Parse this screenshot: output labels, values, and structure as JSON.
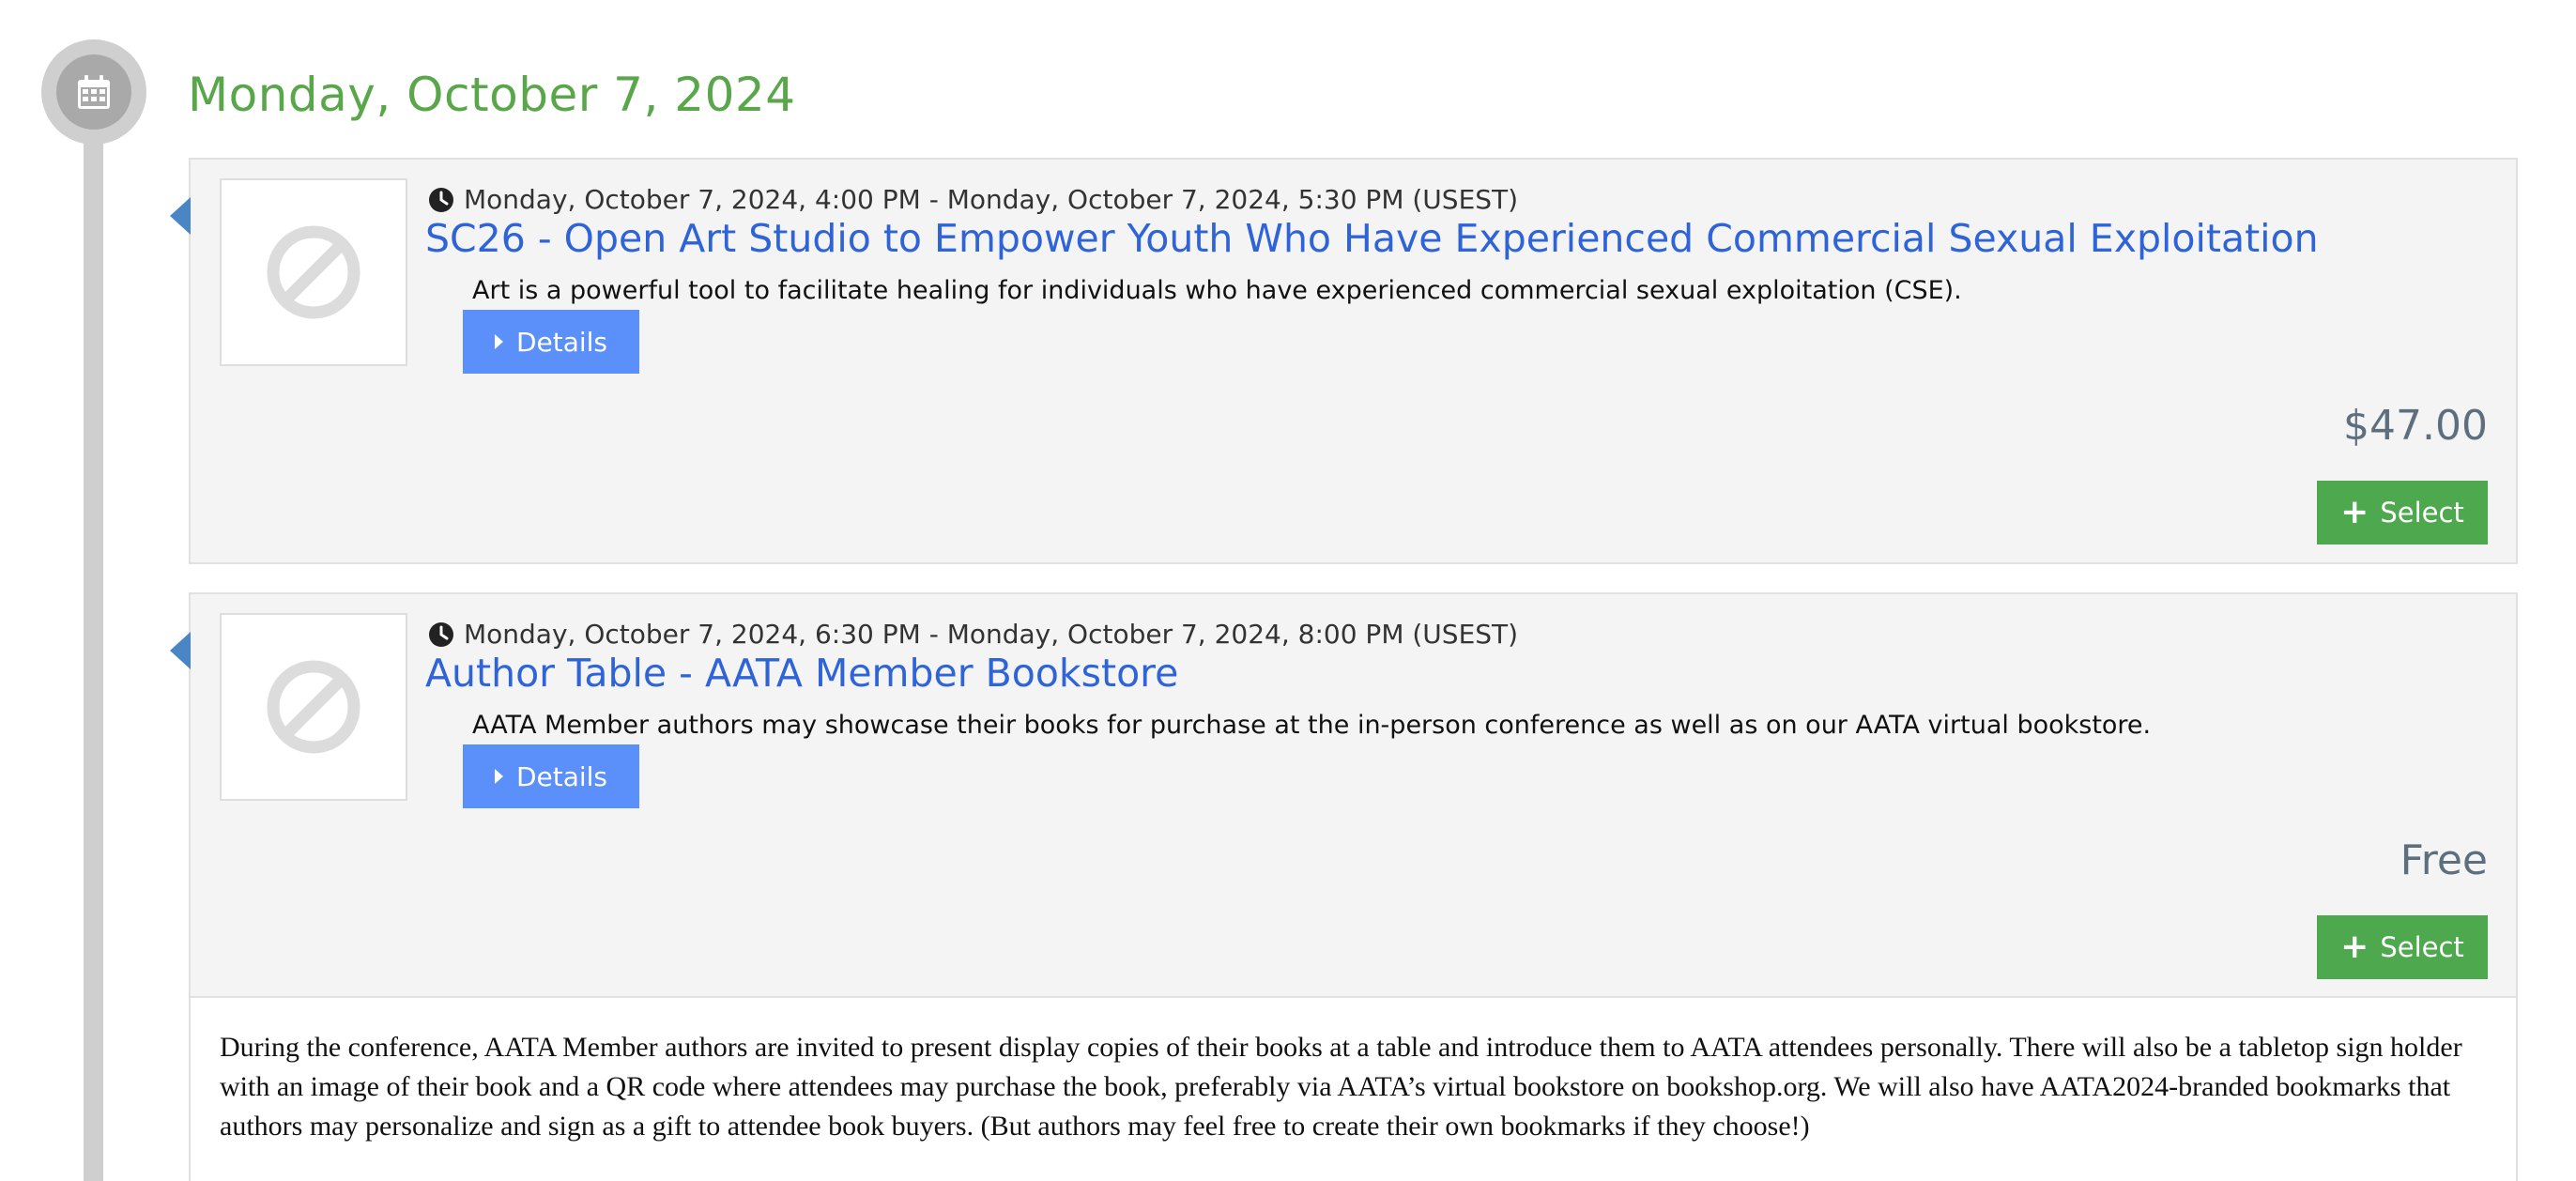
{
  "day": {
    "title": "Monday, October 7, 2024",
    "icon": "calendar-icon"
  },
  "events": [
    {
      "time": "Monday, October 7, 2024, 4:00 PM - Monday, October 7, 2024, 5:30 PM (USEST)",
      "title": "SC26 - Open Art Studio to Empower Youth Who Have Experienced Commercial Sexual Exploitation",
      "description": "Art is a powerful tool to facilitate healing for individuals who have experienced commercial sexual exploitation (CSE).",
      "details_label": "Details",
      "price": "$47.00",
      "select_label": "Select"
    },
    {
      "time": "Monday, October 7, 2024, 6:30 PM - Monday, October 7, 2024, 8:00 PM (USEST)",
      "title": "Author Table - AATA Member Bookstore",
      "description": "AATA Member authors may showcase their books for purchase at the in-person conference as well as on our AATA virtual bookstore.",
      "details_label": "Details",
      "price": "Free",
      "select_label": "Select",
      "expanded_text": "During the conference,  AATA Member authors are invited to present display copies of their books at a table and introduce them to AATA attendees personally. There will also be a tabletop sign holder with an image of their book and a QR code where attendees may purchase the book, preferably via AATA’s virtual bookstore on bookshop.org. We will also have AATA2024-branded bookmarks that authors may personalize and sign as a gift to attendee book buyers. (But authors may feel free to create their own bookmarks if they choose!)"
    }
  ],
  "colors": {
    "day_title": "#5aa64a",
    "event_title": "#2f63d8",
    "details_button": "#5b8ff9",
    "select_button": "#4ea84e",
    "price": "#5d6f7f",
    "timeline_arrow": "#4a86c5"
  }
}
